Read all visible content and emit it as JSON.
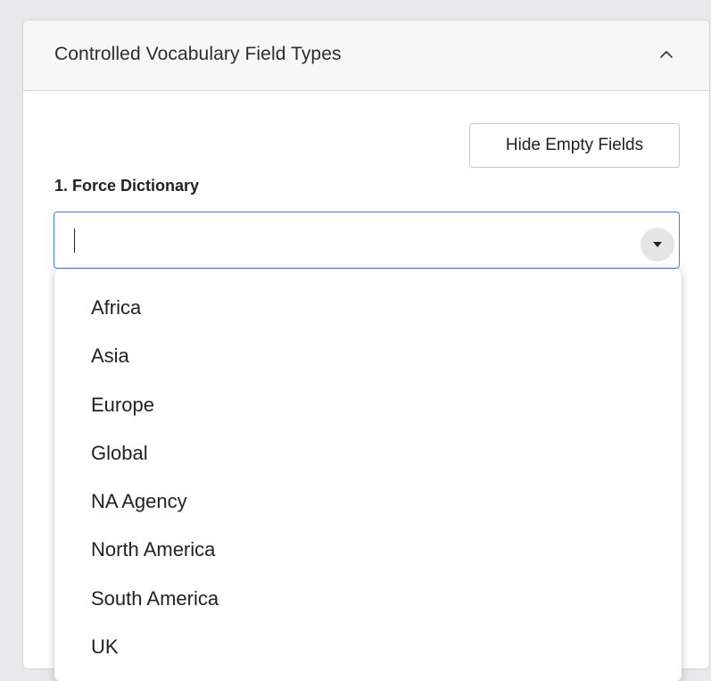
{
  "panel": {
    "title": "Controlled Vocabulary Field Types",
    "collapse_icon": "chevron-up-icon"
  },
  "toolbar": {
    "hide_empty_label": "Hide Empty Fields"
  },
  "field": {
    "label": "1. Force Dictionary",
    "value": "",
    "toggle_icon": "caret-down-icon"
  },
  "dropdown": {
    "options": [
      "Africa",
      "Asia",
      "Europe",
      "Global",
      "NA Agency",
      "North America",
      "South America",
      "UK"
    ]
  },
  "colors": {
    "focus_border": "#3b82f6",
    "header_bg": "#f7f7f8",
    "page_bg": "#e9e9ec"
  }
}
